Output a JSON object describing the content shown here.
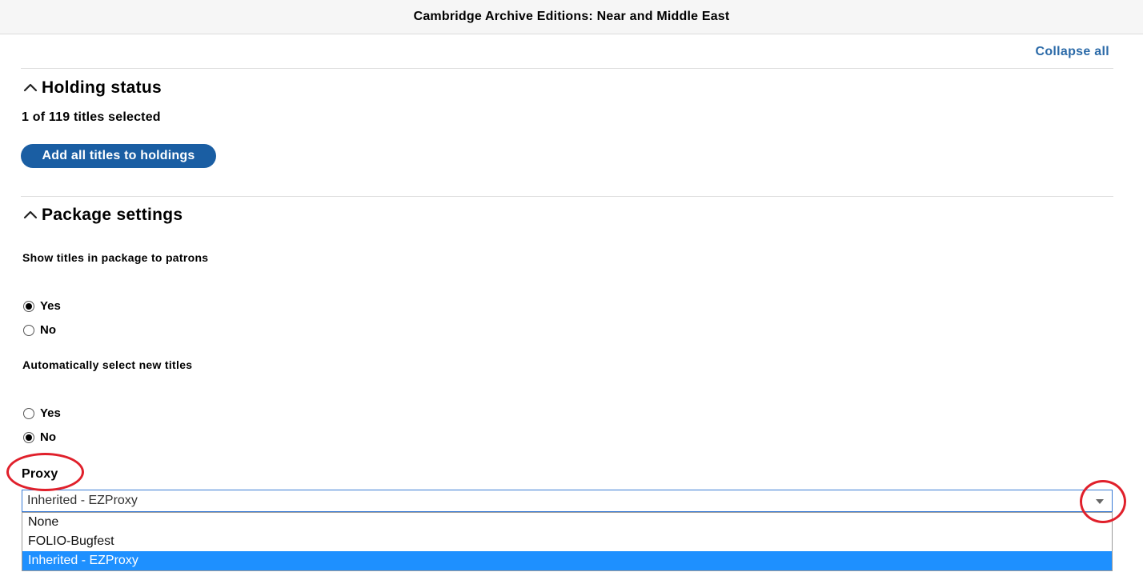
{
  "header": {
    "title": "Cambridge Archive Editions: Near and Middle East"
  },
  "actions": {
    "collapse_all": "Collapse all"
  },
  "holding_status": {
    "title": "Holding status",
    "selected_count": "1 of 119 titles selected",
    "add_all_button": "Add all titles to holdings"
  },
  "package_settings": {
    "title": "Package settings",
    "show_titles": {
      "label": "Show titles in package to patrons",
      "options": [
        {
          "label": "Yes",
          "checked": true
        },
        {
          "label": "No",
          "checked": false
        }
      ]
    },
    "auto_select": {
      "label": "Automatically select new titles",
      "options": [
        {
          "label": "Yes",
          "checked": false
        },
        {
          "label": "No",
          "checked": true
        }
      ]
    }
  },
  "proxy": {
    "label": "Proxy",
    "selected_value": "Inherited - EZProxy",
    "options": [
      {
        "label": "None",
        "selected": false
      },
      {
        "label": "FOLIO-Bugfest",
        "selected": false
      },
      {
        "label": "Inherited - EZProxy",
        "selected": true
      }
    ]
  },
  "colors": {
    "primary_button": "#1a5ea3",
    "link": "#2b6aa8",
    "option_highlight": "#1e90ff",
    "annotation_circle": "#e0202b"
  }
}
